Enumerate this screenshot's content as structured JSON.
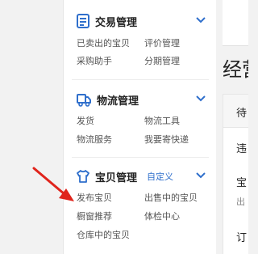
{
  "sidebar": {
    "sections": [
      {
        "title": "交易管理",
        "icon": "order-list-icon",
        "items": [
          "已卖出的宝贝",
          "评价管理",
          "采购助手",
          "分期管理"
        ]
      },
      {
        "title": "物流管理",
        "icon": "truck-icon",
        "items": [
          "发货",
          "物流工具",
          "物流服务",
          "我要寄快递"
        ]
      },
      {
        "title": "宝贝管理",
        "icon": "shirt-icon",
        "custom_link": "自定义",
        "items": [
          "发布宝贝",
          "出售中的宝贝",
          "橱窗推荐",
          "体检中心",
          "仓库中的宝贝"
        ]
      }
    ]
  },
  "main": {
    "title": "经营",
    "table_header": "待",
    "rows": [
      "违",
      "宝",
      "出",
      "订"
    ]
  },
  "colors": {
    "link": "#2f6fcc",
    "icon": "#2f6fcc",
    "arrow": "#e0241c"
  }
}
